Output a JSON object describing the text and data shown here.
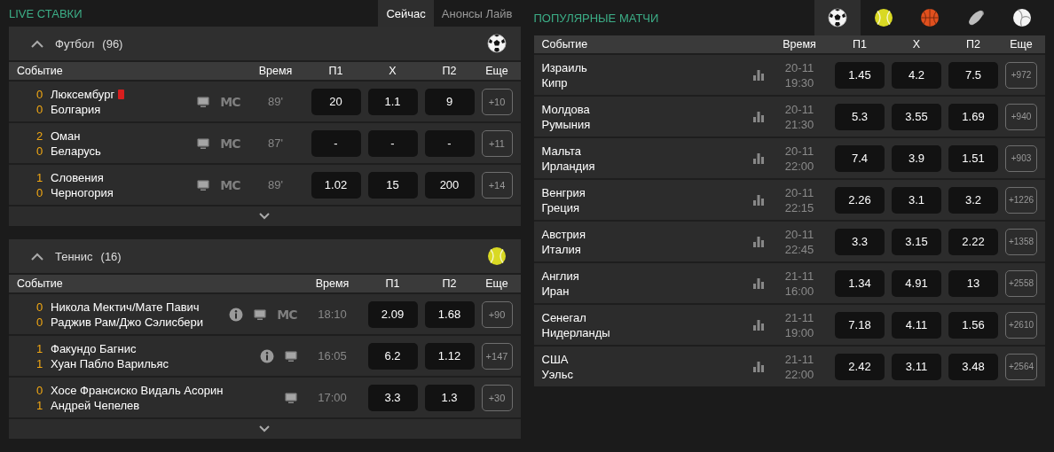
{
  "live": {
    "title": "LIVE СТАВКИ",
    "tabs": [
      {
        "label": "Сейчас",
        "selected": true
      },
      {
        "label": "Анонсы Лайв",
        "selected": false
      }
    ],
    "sports": [
      {
        "name": "Футбол",
        "count": "(96)",
        "kind": "football",
        "expanded": true,
        "columns": {
          "event": "Событие",
          "time": "Время",
          "odds": [
            "П1",
            "X",
            "П2"
          ],
          "more": "Еще"
        },
        "events": [
          {
            "score1": "0",
            "team1": "Люксембург",
            "red_card": true,
            "score2": "0",
            "team2": "Болгария",
            "info": false,
            "tv": true,
            "stream_label": "MC",
            "time": "89'",
            "odds": [
              "20",
              "1.1",
              "9"
            ],
            "more": "+10"
          },
          {
            "score1": "2",
            "team1": "Оман",
            "red_card": false,
            "score2": "0",
            "team2": "Беларусь",
            "info": false,
            "tv": true,
            "stream_label": "MC",
            "time": "87'",
            "odds": [
              "-",
              "-",
              "-"
            ],
            "more": "+11"
          },
          {
            "score1": "1",
            "team1": "Словения",
            "red_card": false,
            "score2": "0",
            "team2": "Черногория",
            "info": false,
            "tv": true,
            "stream_label": "MC",
            "time": "89'",
            "odds": [
              "1.02",
              "15",
              "200"
            ],
            "more": "+14"
          }
        ]
      },
      {
        "name": "Теннис",
        "count": "(16)",
        "kind": "tennis",
        "expanded": true,
        "columns": {
          "event": "Событие",
          "time": "Время",
          "odds": [
            "П1",
            "П2"
          ],
          "more": "Еще"
        },
        "events": [
          {
            "score1": "0",
            "team1": "Никола Мектич/Мате Павич",
            "red_card": false,
            "score2": "0",
            "team2": "Раджив Рам/Джо Сэлисбери",
            "info": true,
            "tv": true,
            "stream_label": "MC",
            "time": "18:10",
            "odds": [
              "2.09",
              "1.68"
            ],
            "more": "+90"
          },
          {
            "score1": "1",
            "team1": "Факундо Багнис",
            "red_card": false,
            "score2": "1",
            "team2": "Хуан Пабло Варильяс",
            "info": true,
            "tv": true,
            "time": "16:05",
            "odds": [
              "6.2",
              "1.12"
            ],
            "more": "+147"
          },
          {
            "score1": "0",
            "team1": "Хосе Франсиско Видаль Асорин",
            "red_card": false,
            "score2": "1",
            "team2": "Андрей Чепелев",
            "info": false,
            "tv": true,
            "time": "17:00",
            "odds": [
              "3.3",
              "1.3"
            ],
            "more": "+30"
          }
        ]
      }
    ]
  },
  "popular": {
    "title": "ПОПУЛЯРНЫЕ МАТЧИ",
    "sport_tabs": [
      {
        "kind": "football",
        "selected": true
      },
      {
        "kind": "tennis",
        "selected": false
      },
      {
        "kind": "basketball",
        "selected": false
      },
      {
        "kind": "hockey",
        "selected": false
      },
      {
        "kind": "volleyball",
        "selected": false
      }
    ],
    "columns": {
      "event": "Событие",
      "time": "Время",
      "odds": [
        "П1",
        "X",
        "П2"
      ],
      "more": "Еще"
    },
    "matches": [
      {
        "team1": "Израиль",
        "team2": "Кипр",
        "date": "20-11",
        "time": "19:30",
        "odds": [
          "1.45",
          "4.2",
          "7.5"
        ],
        "more": "+972"
      },
      {
        "team1": "Молдова",
        "team2": "Румыния",
        "date": "20-11",
        "time": "21:30",
        "odds": [
          "5.3",
          "3.55",
          "1.69"
        ],
        "more": "+940"
      },
      {
        "team1": "Мальта",
        "team2": "Ирландия",
        "date": "20-11",
        "time": "22:00",
        "odds": [
          "7.4",
          "3.9",
          "1.51"
        ],
        "more": "+903"
      },
      {
        "team1": "Венгрия",
        "team2": "Греция",
        "date": "20-11",
        "time": "22:15",
        "odds": [
          "2.26",
          "3.1",
          "3.2"
        ],
        "more": "+1226"
      },
      {
        "team1": "Австрия",
        "team2": "Италия",
        "date": "20-11",
        "time": "22:45",
        "odds": [
          "3.3",
          "3.15",
          "2.22"
        ],
        "more": "+1358"
      },
      {
        "team1": "Англия",
        "team2": "Иран",
        "date": "21-11",
        "time": "16:00",
        "odds": [
          "1.34",
          "4.91",
          "13"
        ],
        "more": "+2558"
      },
      {
        "team1": "Сенегал",
        "team2": "Нидерланды",
        "date": "21-11",
        "time": "19:00",
        "odds": [
          "7.18",
          "4.11",
          "1.56"
        ],
        "more": "+2610"
      },
      {
        "team1": "США",
        "team2": "Уэльс",
        "date": "21-11",
        "time": "22:00",
        "odds": [
          "2.42",
          "3.11",
          "3.48"
        ],
        "more": "+2564"
      }
    ]
  }
}
